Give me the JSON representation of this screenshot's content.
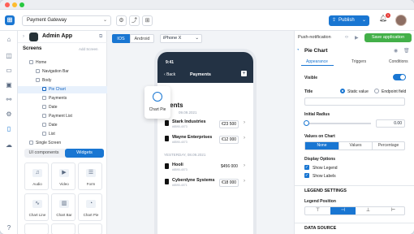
{
  "toolbar": {
    "project": "Payment Gateway",
    "publish_label": "Publish",
    "notification_count": "1"
  },
  "screens_panel": {
    "app_name": "Admin App",
    "title": "Screens",
    "add_screen": "Add Screen",
    "tree": [
      {
        "label": "Home"
      },
      {
        "label": "Navigation Bar"
      },
      {
        "label": "Body"
      },
      {
        "label": "Pie Chart"
      },
      {
        "label": "Payments"
      },
      {
        "label": "Date"
      },
      {
        "label": "Payment List"
      },
      {
        "label": "Date"
      },
      {
        "label": "List"
      },
      {
        "label": "Single Screen"
      }
    ],
    "tabs": [
      "UI components",
      "Widgets"
    ],
    "active_tab": "Widgets"
  },
  "widgets": [
    {
      "label": "Audio",
      "icon": "audio-icon"
    },
    {
      "label": "Video",
      "icon": "video-icon"
    },
    {
      "label": "Form",
      "icon": "form-icon"
    },
    {
      "label": "Chart Line",
      "icon": "chart-line-icon"
    },
    {
      "label": "Chart Bar",
      "icon": "chart-bar-icon"
    },
    {
      "label": "Chart Pie",
      "icon": "chart-pie-icon"
    }
  ],
  "canvas": {
    "os_tabs": [
      "IOS",
      "Android"
    ],
    "active_os": "IOS",
    "device": "iPhone X",
    "push_notification": "Push-notification"
  },
  "phone": {
    "time": "9:41",
    "back": "Back",
    "title": "Payments",
    "heading": "ments",
    "drag_label": "Chart Pie",
    "groups": [
      {
        "date": "09.09.2021",
        "rows": [
          {
            "name": "Stark Industries",
            "sub": "#8590-4073",
            "amount": "€23 500",
            "boxed": true
          },
          {
            "name": "Wayne Enterprises",
            "sub": "#8590-4073",
            "amount": "€12 000",
            "boxed": true
          }
        ]
      },
      {
        "date": "YESTERDAY, 08.09.2021",
        "rows": [
          {
            "name": "Hooli",
            "sub": "#8590-4073",
            "amount": "$456 000",
            "boxed": false
          },
          {
            "name": "Cyberdyne Systems",
            "sub": "#8590-4071",
            "amount": "€18 000",
            "boxed": true
          }
        ]
      }
    ]
  },
  "props": {
    "save_label": "Save application",
    "component": "Pie Chart",
    "tabs": [
      "Appearance",
      "Triggers",
      "Conditions"
    ],
    "visible_label": "Visible",
    "title_label": "Title",
    "title_opts": [
      "Static value",
      "Endpoint field"
    ],
    "radius_label": "Initial Radius",
    "radius_value": "0.00",
    "values_label": "Values on Chart",
    "values_opts": [
      "None",
      "Values",
      "Percentage"
    ],
    "display_label": "Display Options",
    "show_legend": "Show Legend",
    "show_labels": "Show Labels",
    "legend_section": "LEGEND SETTINGS",
    "legend_position": "Legend Position",
    "legend_opts": [
      "⊤",
      "⊣",
      "⊥",
      "⊢"
    ],
    "datasource_section": "DATA SOURCE",
    "accent": "#1976d2"
  }
}
